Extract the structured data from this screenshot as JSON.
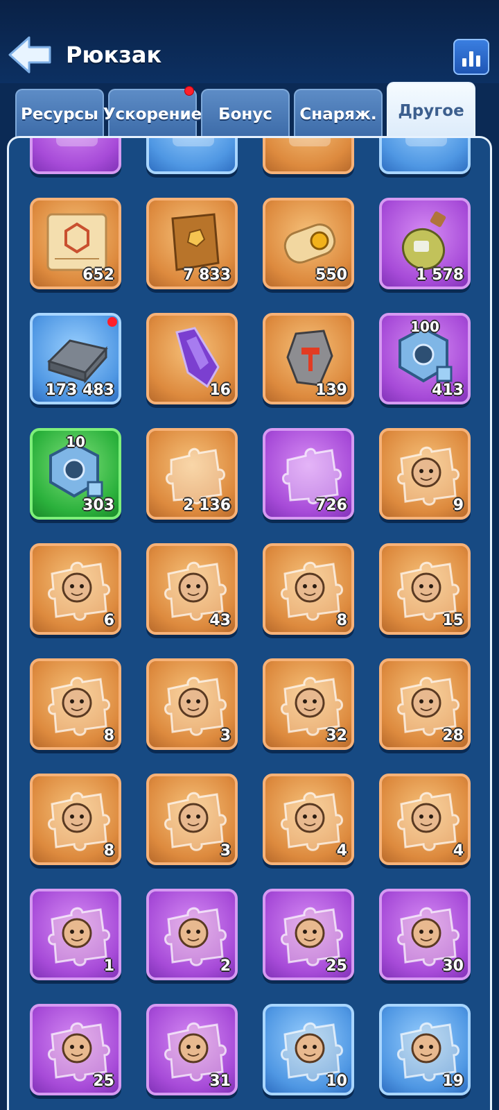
{
  "header": {
    "title": "Рюкзак",
    "back_icon": "back-arrow-icon",
    "stats_icon": "bar-chart-icon"
  },
  "tabs": [
    {
      "label": "Ресурсы",
      "active": false,
      "badge": false
    },
    {
      "label": "Ускорение",
      "active": false,
      "badge": true
    },
    {
      "label": "Бонус",
      "active": false,
      "badge": false
    },
    {
      "label": "Снаряж.",
      "active": false,
      "badge": false
    },
    {
      "label": "Другое",
      "active": true,
      "badge": false
    }
  ],
  "colors": {
    "background": "#0b2a55",
    "panel": "#174a83",
    "badge_red": "#ff1f2a"
  },
  "items": [
    {
      "rarity": "purple",
      "icon": "partial-item-icon",
      "count": "",
      "top_label": ""
    },
    {
      "rarity": "blue",
      "icon": "partial-item-icon",
      "count": "",
      "top_label": ""
    },
    {
      "rarity": "orange",
      "icon": "partial-item-icon",
      "count": "",
      "top_label": ""
    },
    {
      "rarity": "blue",
      "icon": "partial-item-icon",
      "count": "",
      "top_label": ""
    },
    {
      "rarity": "orange",
      "icon": "blueprint-scroll-icon",
      "count": "652",
      "top_label": ""
    },
    {
      "rarity": "orange",
      "icon": "book-icon",
      "count": "7 833",
      "top_label": ""
    },
    {
      "rarity": "orange",
      "icon": "rolled-scroll-icon",
      "count": "550",
      "top_label": ""
    },
    {
      "rarity": "purple",
      "icon": "potion-bottle-icon",
      "count": "1 578",
      "top_label": ""
    },
    {
      "rarity": "blue",
      "icon": "metal-ingot-icon",
      "count": "173 483",
      "top_label": "",
      "badge": true
    },
    {
      "rarity": "orange",
      "icon": "purple-crystal-icon",
      "count": "16",
      "top_label": ""
    },
    {
      "rarity": "orange",
      "icon": "hammer-stone-icon",
      "count": "139",
      "top_label": ""
    },
    {
      "rarity": "purple",
      "icon": "hex-nut-icon",
      "count": "413",
      "top_label": "100"
    },
    {
      "rarity": "green",
      "icon": "hex-nut-icon",
      "count": "303",
      "top_label": "10"
    },
    {
      "rarity": "orange",
      "icon": "puzzle-piece-icon",
      "count": "2 136",
      "top_label": ""
    },
    {
      "rarity": "purple",
      "icon": "puzzle-piece-icon",
      "count": "726",
      "top_label": ""
    },
    {
      "rarity": "orange",
      "icon": "hero-shard-icon",
      "count": "9",
      "top_label": ""
    },
    {
      "rarity": "orange",
      "icon": "hero-shard-icon",
      "count": "6",
      "top_label": ""
    },
    {
      "rarity": "orange",
      "icon": "hero-shard-icon",
      "count": "43",
      "top_label": ""
    },
    {
      "rarity": "orange",
      "icon": "hero-shard-icon",
      "count": "8",
      "top_label": ""
    },
    {
      "rarity": "orange",
      "icon": "hero-shard-icon",
      "count": "15",
      "top_label": ""
    },
    {
      "rarity": "orange",
      "icon": "hero-shard-icon",
      "count": "8",
      "top_label": ""
    },
    {
      "rarity": "orange",
      "icon": "hero-shard-icon",
      "count": "3",
      "top_label": ""
    },
    {
      "rarity": "orange",
      "icon": "hero-shard-icon",
      "count": "32",
      "top_label": ""
    },
    {
      "rarity": "orange",
      "icon": "hero-shard-icon",
      "count": "28",
      "top_label": ""
    },
    {
      "rarity": "orange",
      "icon": "hero-shard-icon",
      "count": "8",
      "top_label": ""
    },
    {
      "rarity": "orange",
      "icon": "hero-shard-icon",
      "count": "3",
      "top_label": ""
    },
    {
      "rarity": "orange",
      "icon": "hero-shard-icon",
      "count": "4",
      "top_label": ""
    },
    {
      "rarity": "orange",
      "icon": "hero-shard-icon",
      "count": "4",
      "top_label": ""
    },
    {
      "rarity": "purple",
      "icon": "hero-shard-icon",
      "count": "1",
      "top_label": ""
    },
    {
      "rarity": "purple",
      "icon": "hero-shard-icon",
      "count": "2",
      "top_label": ""
    },
    {
      "rarity": "purple",
      "icon": "hero-shard-icon",
      "count": "25",
      "top_label": ""
    },
    {
      "rarity": "purple",
      "icon": "hero-shard-icon",
      "count": "30",
      "top_label": ""
    },
    {
      "rarity": "purple",
      "icon": "hero-shard-icon",
      "count": "25",
      "top_label": ""
    },
    {
      "rarity": "purple",
      "icon": "hero-shard-icon",
      "count": "31",
      "top_label": ""
    },
    {
      "rarity": "blue",
      "icon": "hero-shard-icon",
      "count": "10",
      "top_label": ""
    },
    {
      "rarity": "blue",
      "icon": "hero-shard-icon",
      "count": "19",
      "top_label": ""
    }
  ]
}
